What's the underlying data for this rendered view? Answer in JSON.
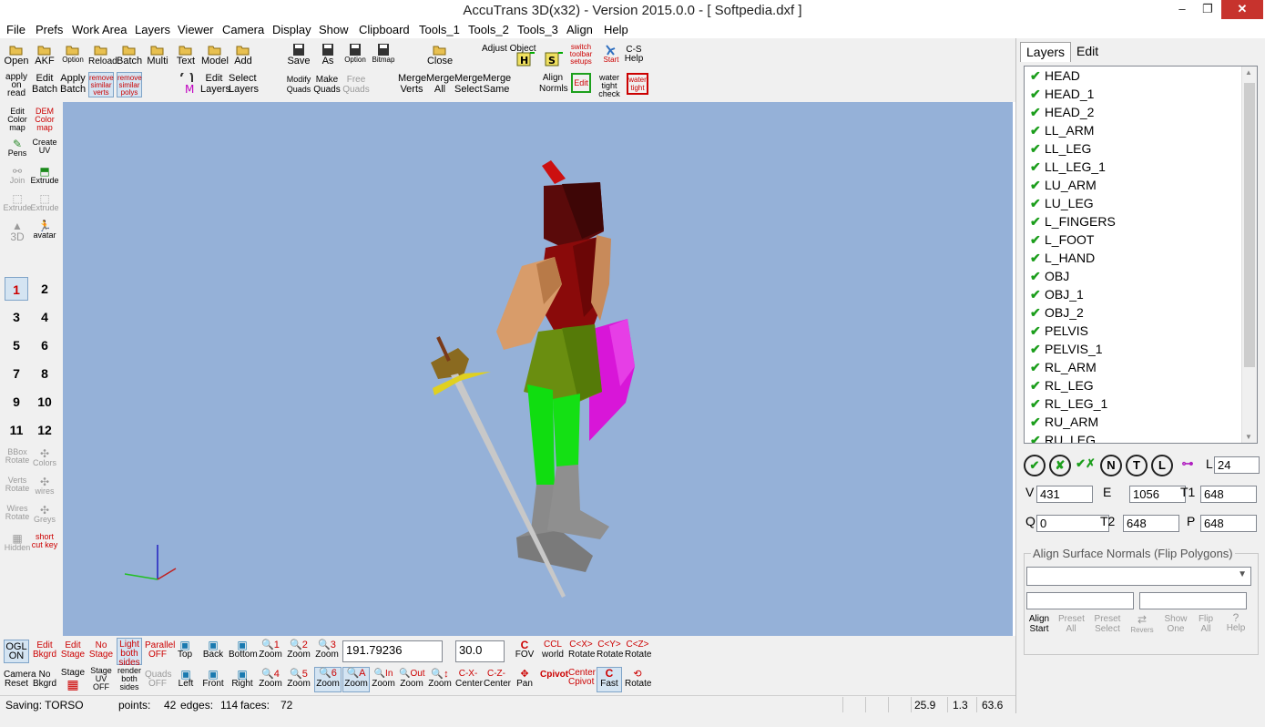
{
  "window": {
    "title": "AccuTrans 3D(x32) - Version 2015.0.0 - [ Softpedia.dxf ]",
    "min": "–",
    "max": "❐",
    "close": "✕"
  },
  "menu": [
    "File",
    "Prefs",
    "Work Area",
    "Layers",
    "Viewer",
    "Camera",
    "Display",
    "Show",
    "Clipboard",
    "Tools_1",
    "Tools_2",
    "Tools_3",
    "Align",
    "Help"
  ],
  "toolbar": {
    "row1": {
      "open": "Open",
      "akf": "AKF",
      "option": "Option",
      "reload": "Reload",
      "batch": "Batch",
      "multi": "Multi",
      "text": "Text",
      "model": "Model",
      "add": "Add",
      "save": "Save",
      "as": "As",
      "option2": "Option",
      "bitmap": "Bitmap",
      "close": "Close",
      "adjust_object": "Adjust Object",
      "switch_toolbar": "switch toolbar setups",
      "start": "Start",
      "cs_help": "C-S Help"
    },
    "row2": {
      "apply_on_read": "apply on read",
      "edit_batch": "Edit Batch",
      "apply_batch": "Apply Batch",
      "remove_similar_verts": "remove similar verts",
      "remove_similar_polys": "remove similar polys",
      "edit_layers": "Edit Layers",
      "select_layers": "Select Layers",
      "modify_quads": "Modify Quads",
      "make_quads": "Make Quads",
      "free_quads": "Free Quads",
      "merge_verts": "Merge Verts",
      "merge_all": "Merge All",
      "merge_select": "Merge Select",
      "merge_same": "Merge Same",
      "align_normals": "Align Normls",
      "edit": "Edit",
      "water_tight_check": "water tight check",
      "water_tight": "water tight"
    }
  },
  "lefttools": {
    "edit_color_map": "Edit Color map",
    "dem_color_map": "DEM Color map",
    "pens": "Pens",
    "create_uv": "Create UV",
    "join": "Join",
    "extrude": "Extrude",
    "extrude_k": "Extrude",
    "extrude_m": "Extrude",
    "d3d": "3D",
    "avatar": "avatar",
    "numbers": [
      "1",
      "2",
      "3",
      "4",
      "5",
      "6",
      "7",
      "8",
      "9",
      "10",
      "11",
      "12"
    ],
    "bbox_rotate": "BBox Rotate",
    "colors": "Colors",
    "verts_rotate": "Verts Rotate",
    "wires": "wires",
    "wires_rotate": "Wires Rotate",
    "greys": "Greys",
    "hidden": "Hidden",
    "shortcut_key": "short cut key"
  },
  "bottom": {
    "ogl_on": "OGL ON",
    "edit_bkgrd": "Edit Bkgrd",
    "edit_stage": "Edit Stage",
    "no_stage": "No Stage",
    "light_both_sides": "Light both sides",
    "parallel_off": "Parallel OFF",
    "top": "Top",
    "back": "Back",
    "bottom": "Bottom",
    "zoom": "Zoom",
    "camera_reset": "Camera Reset",
    "no_bkgrd": "No Bkgrd",
    "stage": "Stage",
    "stage_uv_off": "Stage UV OFF",
    "render_both_sides": "render both sides",
    "quads_off": "Quads OFF",
    "left": "Left",
    "front": "Front",
    "right": "Right",
    "zoom_in": "Zoom",
    "zoom_out": "Zoom",
    "zoom_last": "Zoom",
    "value1": "191.79236",
    "value2": "30.0",
    "fov": "FOV",
    "world": "world",
    "rotate_x": "Rotate",
    "rotate_y": "Rotate",
    "rotate_z": "Rotate",
    "center_x": "Center",
    "center_z": "Center",
    "pan": "Pan",
    "cpivot": "Cpivot",
    "center_cpivot": "Center Cpivot",
    "fast": "Fast",
    "rotate": "Rotate"
  },
  "status": {
    "saving": "Saving: TORSO",
    "points_lbl": "points:",
    "points": "42",
    "edges_lbl": "edges:",
    "edges": "114",
    "faces_lbl": "faces:",
    "faces": "72",
    "v1": "25.9",
    "v2": "1.3",
    "v3": "63.6"
  },
  "panel": {
    "tab_layers": "Layers",
    "tab_edit": "Edit",
    "layers": [
      "HEAD",
      "HEAD_1",
      "HEAD_2",
      "LL_ARM",
      "LL_LEG",
      "LL_LEG_1",
      "LU_ARM",
      "LU_LEG",
      "L_FINGERS",
      "L_FOOT",
      "L_HAND",
      "OBJ",
      "OBJ_1",
      "OBJ_2",
      "PELVIS",
      "PELVIS_1",
      "RL_ARM",
      "RL_LEG",
      "RL_LEG_1",
      "RU_ARM",
      "RU_LEG"
    ],
    "l_label": "L",
    "l_value": "24",
    "v_label": "V",
    "v_value": "431",
    "e_label": "E",
    "e_value": "1056",
    "t1_label": "T1",
    "t1_value": "648",
    "q_label": "Q",
    "q_value": "0",
    "t2_label": "T2",
    "t2_value": "648",
    "p_label": "P",
    "p_value": "648",
    "align_title": "Align Surface Normals (Flip Polygons)",
    "align_start": "Align Start",
    "preset_all": "Preset All",
    "preset_select": "Preset Select",
    "revers": "Revers",
    "show_one": "Show One",
    "flip_all": "Flip All",
    "help": "Help"
  }
}
